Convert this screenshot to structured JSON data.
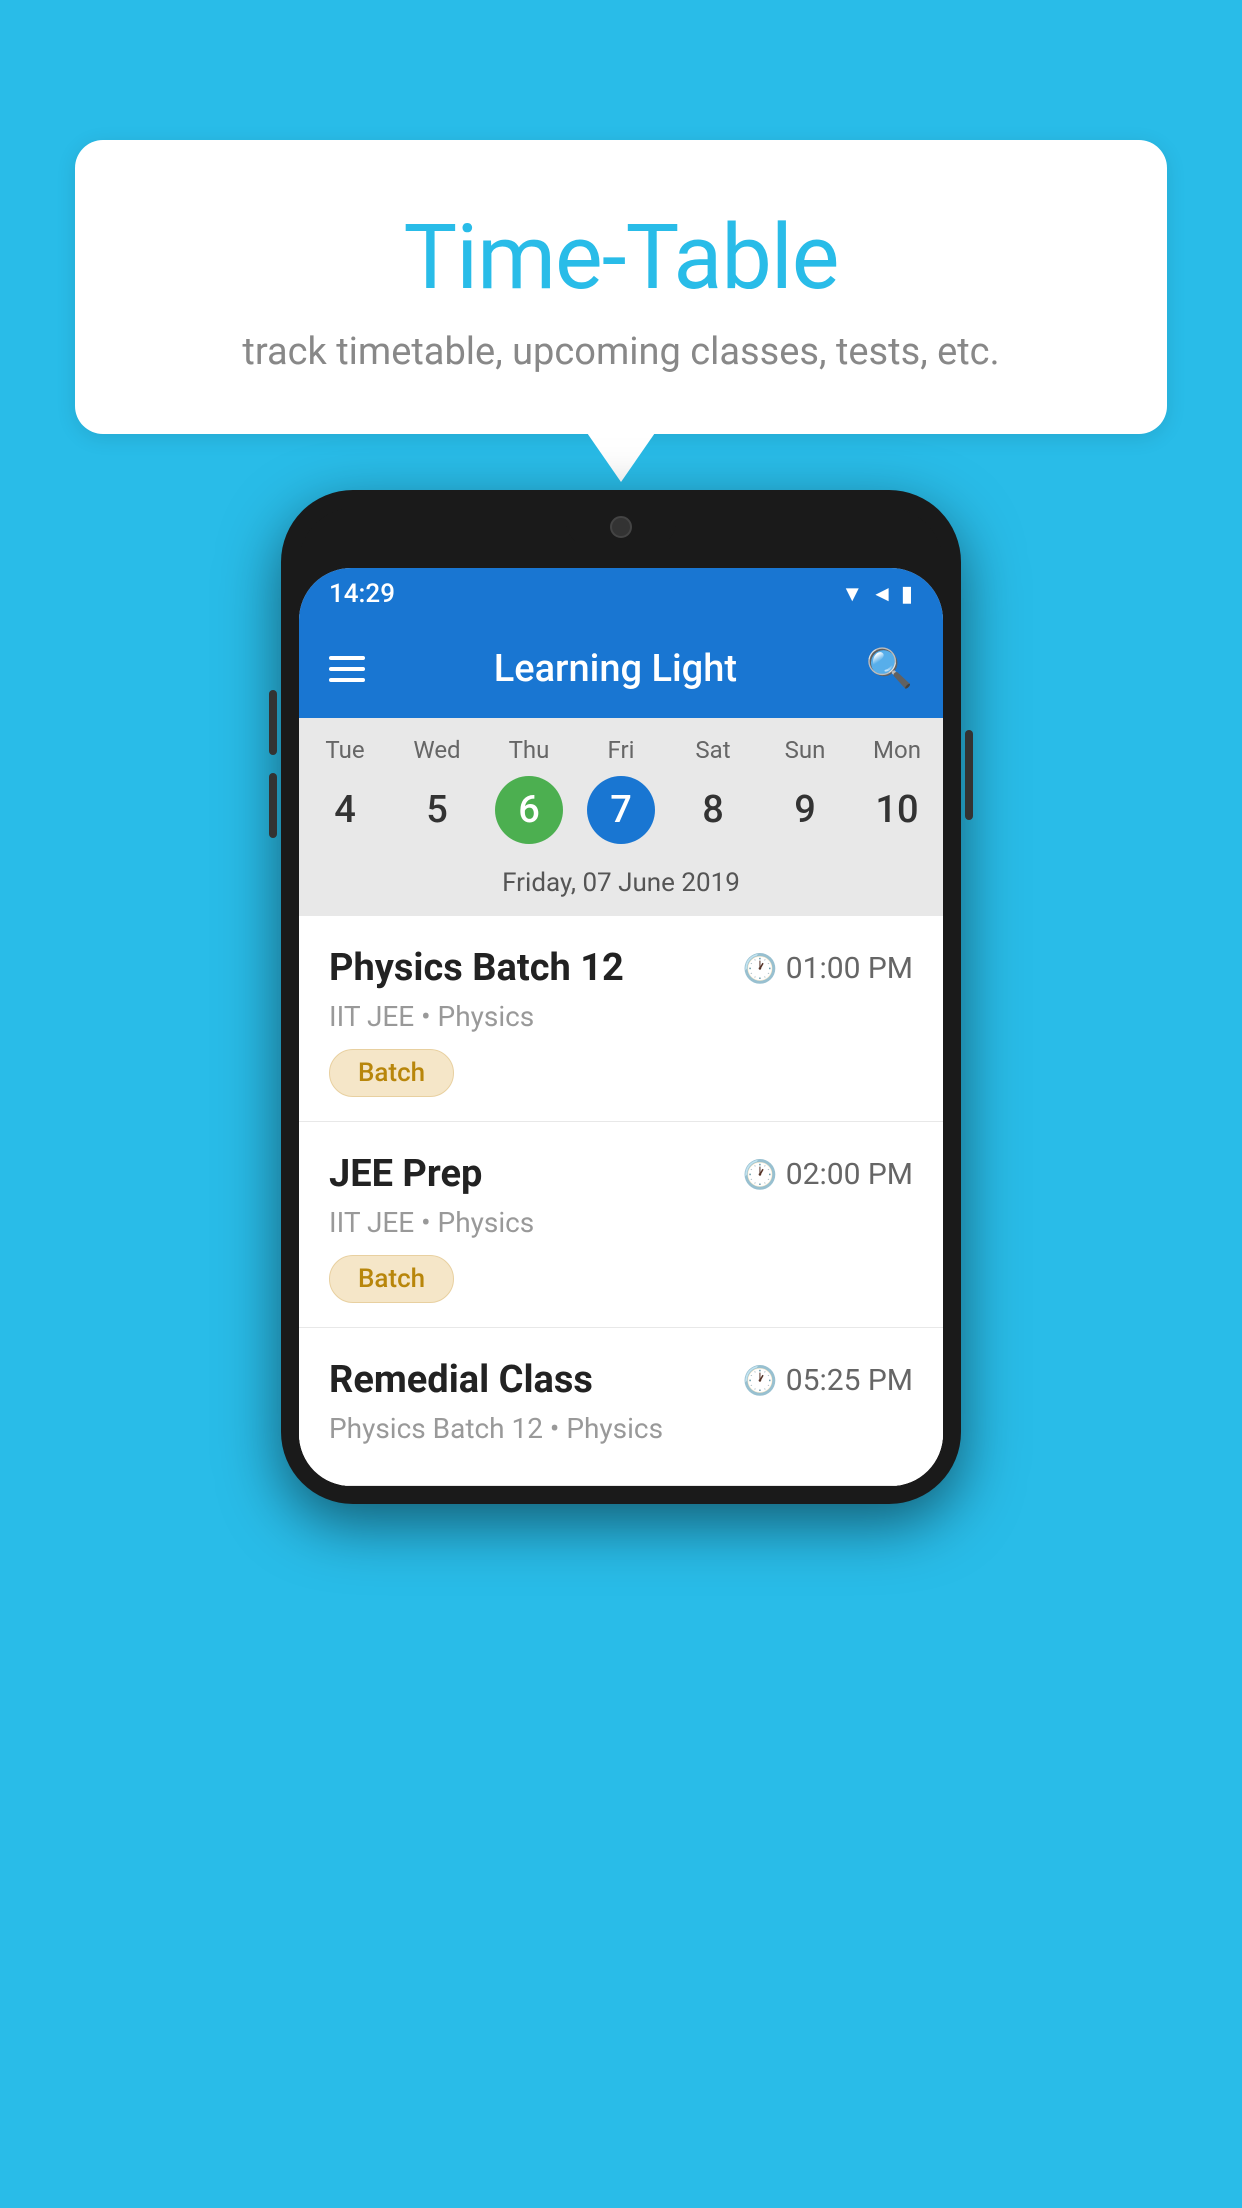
{
  "background_color": "#29bce8",
  "speech_bubble": {
    "title": "Time-Table",
    "subtitle": "track timetable, upcoming classes, tests, etc."
  },
  "phone": {
    "status_bar": {
      "time": "14:29"
    },
    "app_bar": {
      "title": "Learning Light"
    },
    "calendar": {
      "weekdays": [
        {
          "label": "Tue",
          "number": "4",
          "state": "normal"
        },
        {
          "label": "Wed",
          "number": "5",
          "state": "normal"
        },
        {
          "label": "Thu",
          "number": "6",
          "state": "today"
        },
        {
          "label": "Fri",
          "number": "7",
          "state": "selected"
        },
        {
          "label": "Sat",
          "number": "8",
          "state": "normal"
        },
        {
          "label": "Sun",
          "number": "9",
          "state": "normal"
        },
        {
          "label": "Mon",
          "number": "10",
          "state": "normal"
        }
      ],
      "selected_date_label": "Friday, 07 June 2019"
    },
    "schedule": [
      {
        "title": "Physics Batch 12",
        "time": "01:00 PM",
        "subtitle": "IIT JEE • Physics",
        "badge": "Batch"
      },
      {
        "title": "JEE Prep",
        "time": "02:00 PM",
        "subtitle": "IIT JEE • Physics",
        "badge": "Batch"
      },
      {
        "title": "Remedial Class",
        "time": "05:25 PM",
        "subtitle": "Physics Batch 12 • Physics",
        "badge": null
      }
    ]
  }
}
